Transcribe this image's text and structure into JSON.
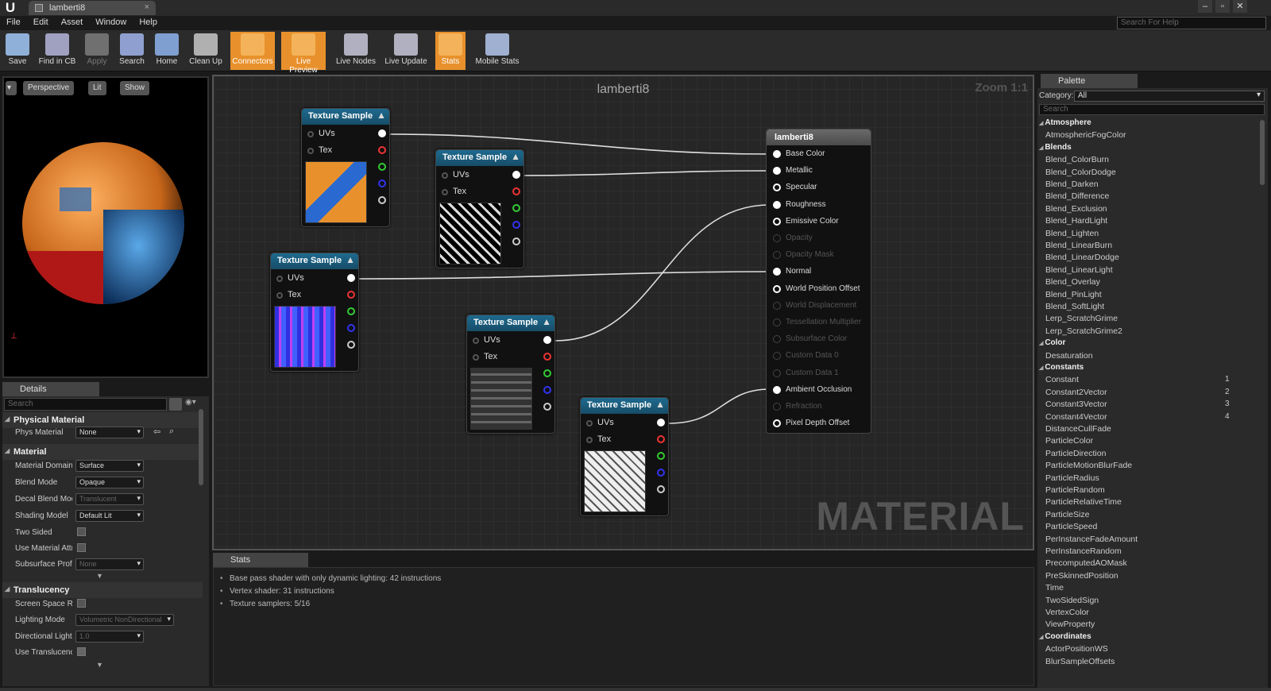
{
  "window": {
    "tab_title": "lamberti8",
    "help_search_placeholder": "Search For Help"
  },
  "menu": [
    "File",
    "Edit",
    "Asset",
    "Window",
    "Help"
  ],
  "toolbar": [
    {
      "label": "Save",
      "icon": "save-icon",
      "state": "normal",
      "color": "#8fb0d8"
    },
    {
      "label": "Find in CB",
      "icon": "find-icon",
      "state": "normal",
      "color": "#a0a0c0"
    },
    {
      "label": "Apply",
      "icon": "apply-icon",
      "state": "disabled",
      "color": "#707070"
    },
    {
      "label": "Search",
      "icon": "search-icon",
      "state": "normal",
      "color": "#8fa0d0"
    },
    {
      "label": "Home",
      "icon": "home-icon",
      "state": "normal",
      "color": "#7f9fd0"
    },
    {
      "label": "Clean Up",
      "icon": "cleanup-icon",
      "state": "normal",
      "color": "#b0b0b0"
    },
    {
      "label": "Connectors",
      "icon": "connectors-icon",
      "state": "active",
      "color": "#e8912c"
    },
    {
      "label": "Live Preview",
      "icon": "live-preview-icon",
      "state": "active",
      "color": "#e8912c"
    },
    {
      "label": "Live Nodes",
      "icon": "live-nodes-icon",
      "state": "normal",
      "color": "#b0b0c0"
    },
    {
      "label": "Live Update",
      "icon": "live-update-icon",
      "state": "normal",
      "color": "#b0b0c0"
    },
    {
      "label": "Stats",
      "icon": "stats-icon",
      "state": "active",
      "color": "#e8912c"
    },
    {
      "label": "Mobile Stats",
      "icon": "mobile-stats-icon",
      "state": "normal",
      "color": "#9fb0d0"
    }
  ],
  "viewport": {
    "perspective": "Perspective",
    "lit": "Lit",
    "show": "Show"
  },
  "details": {
    "tab": "Details",
    "search_placeholder": "Search",
    "sections": {
      "physical": "Physical Material",
      "material": "Material",
      "translucency": "Translucency"
    },
    "props": {
      "phys_material": {
        "label": "Phys Material",
        "value": "None"
      },
      "material_domain": {
        "label": "Material Domain",
        "value": "Surface"
      },
      "blend_mode": {
        "label": "Blend Mode",
        "value": "Opaque"
      },
      "decal_blend": {
        "label": "Decal Blend Mode",
        "value": "Translucent"
      },
      "shading_model": {
        "label": "Shading Model",
        "value": "Default Lit"
      },
      "two_sided": {
        "label": "Two Sided"
      },
      "use_material_attr": {
        "label": "Use Material Attributes"
      },
      "subsurface": {
        "label": "Subsurface Profile",
        "value": "None"
      },
      "screen_space": {
        "label": "Screen Space Reflections"
      },
      "lighting_mode": {
        "label": "Lighting Mode",
        "value": "Volumetric NonDirectional"
      },
      "directional": {
        "label": "Directional Lighting Intensity",
        "value": "1.0"
      },
      "use_translucency": {
        "label": "Use Translucency Vertex Fog"
      }
    }
  },
  "graph": {
    "title": "lamberti8",
    "zoom": "Zoom 1:1",
    "watermark": "MATERIAL",
    "texture_nodes": [
      {
        "title": "Texture Sample",
        "pin_uvs": "UVs",
        "pin_tex": "Tex",
        "thumb": "orange-blue"
      },
      {
        "title": "Texture Sample",
        "pin_uvs": "UVs",
        "pin_tex": "Tex",
        "thumb": "black-white"
      },
      {
        "title": "Texture Sample",
        "pin_uvs": "UVs",
        "pin_tex": "Tex",
        "thumb": "normal-blue"
      },
      {
        "title": "Texture Sample",
        "pin_uvs": "UVs",
        "pin_tex": "Tex",
        "thumb": "dark-grey"
      },
      {
        "title": "Texture Sample",
        "pin_uvs": "UVs",
        "pin_tex": "Tex",
        "thumb": "light-grey"
      }
    ],
    "material_node": {
      "title": "lamberti8",
      "inputs": [
        {
          "label": "Base Color",
          "state": "connected"
        },
        {
          "label": "Metallic",
          "state": "connected"
        },
        {
          "label": "Specular",
          "state": "open"
        },
        {
          "label": "Roughness",
          "state": "connected"
        },
        {
          "label": "Emissive Color",
          "state": "open"
        },
        {
          "label": "Opacity",
          "state": "disabled"
        },
        {
          "label": "Opacity Mask",
          "state": "disabled"
        },
        {
          "label": "Normal",
          "state": "connected"
        },
        {
          "label": "World Position Offset",
          "state": "open"
        },
        {
          "label": "World Displacement",
          "state": "disabled"
        },
        {
          "label": "Tessellation Multiplier",
          "state": "disabled"
        },
        {
          "label": "Subsurface Color",
          "state": "disabled"
        },
        {
          "label": "Custom Data 0",
          "state": "disabled"
        },
        {
          "label": "Custom Data 1",
          "state": "disabled"
        },
        {
          "label": "Ambient Occlusion",
          "state": "connected"
        },
        {
          "label": "Refraction",
          "state": "disabled"
        },
        {
          "label": "Pixel Depth Offset",
          "state": "open"
        }
      ]
    }
  },
  "stats": {
    "tab": "Stats",
    "lines": [
      "Base pass shader with only dynamic lighting: 42 instructions",
      "Vertex shader: 31 instructions",
      "Texture samplers: 5/16"
    ]
  },
  "palette": {
    "tab": "Palette",
    "category_label": "Category:",
    "category_value": "All",
    "search_placeholder": "Search",
    "items": [
      {
        "t": "cat",
        "label": "Atmosphere"
      },
      {
        "t": "it",
        "label": "AtmosphericFogColor"
      },
      {
        "t": "cat",
        "label": "Blends"
      },
      {
        "t": "it",
        "label": "Blend_ColorBurn"
      },
      {
        "t": "it",
        "label": "Blend_ColorDodge"
      },
      {
        "t": "it",
        "label": "Blend_Darken"
      },
      {
        "t": "it",
        "label": "Blend_Difference"
      },
      {
        "t": "it",
        "label": "Blend_Exclusion"
      },
      {
        "t": "it",
        "label": "Blend_HardLight"
      },
      {
        "t": "it",
        "label": "Blend_Lighten"
      },
      {
        "t": "it",
        "label": "Blend_LinearBurn"
      },
      {
        "t": "it",
        "label": "Blend_LinearDodge"
      },
      {
        "t": "it",
        "label": "Blend_LinearLight"
      },
      {
        "t": "it",
        "label": "Blend_Overlay"
      },
      {
        "t": "it",
        "label": "Blend_PinLight"
      },
      {
        "t": "it",
        "label": "Blend_SoftLight"
      },
      {
        "t": "it",
        "label": "Lerp_ScratchGrime"
      },
      {
        "t": "it",
        "label": "Lerp_ScratchGrime2"
      },
      {
        "t": "cat",
        "label": "Color"
      },
      {
        "t": "it",
        "label": "Desaturation"
      },
      {
        "t": "cat",
        "label": "Constants"
      },
      {
        "t": "it",
        "label": "Constant",
        "num": "1"
      },
      {
        "t": "it",
        "label": "Constant2Vector",
        "num": "2"
      },
      {
        "t": "it",
        "label": "Constant3Vector",
        "num": "3"
      },
      {
        "t": "it",
        "label": "Constant4Vector",
        "num": "4"
      },
      {
        "t": "it",
        "label": "DistanceCullFade"
      },
      {
        "t": "it",
        "label": "ParticleColor"
      },
      {
        "t": "it",
        "label": "ParticleDirection"
      },
      {
        "t": "it",
        "label": "ParticleMotionBlurFade"
      },
      {
        "t": "it",
        "label": "ParticleRadius"
      },
      {
        "t": "it",
        "label": "ParticleRandom"
      },
      {
        "t": "it",
        "label": "ParticleRelativeTime"
      },
      {
        "t": "it",
        "label": "ParticleSize"
      },
      {
        "t": "it",
        "label": "ParticleSpeed"
      },
      {
        "t": "it",
        "label": "PerInstanceFadeAmount"
      },
      {
        "t": "it",
        "label": "PerInstanceRandom"
      },
      {
        "t": "it",
        "label": "PrecomputedAOMask"
      },
      {
        "t": "it",
        "label": "PreSkinnedPosition"
      },
      {
        "t": "it",
        "label": "Time"
      },
      {
        "t": "it",
        "label": "TwoSidedSign"
      },
      {
        "t": "it",
        "label": "VertexColor"
      },
      {
        "t": "it",
        "label": "ViewProperty"
      },
      {
        "t": "cat",
        "label": "Coordinates"
      },
      {
        "t": "it",
        "label": "ActorPositionWS"
      },
      {
        "t": "it",
        "label": "BlurSampleOffsets"
      }
    ]
  }
}
